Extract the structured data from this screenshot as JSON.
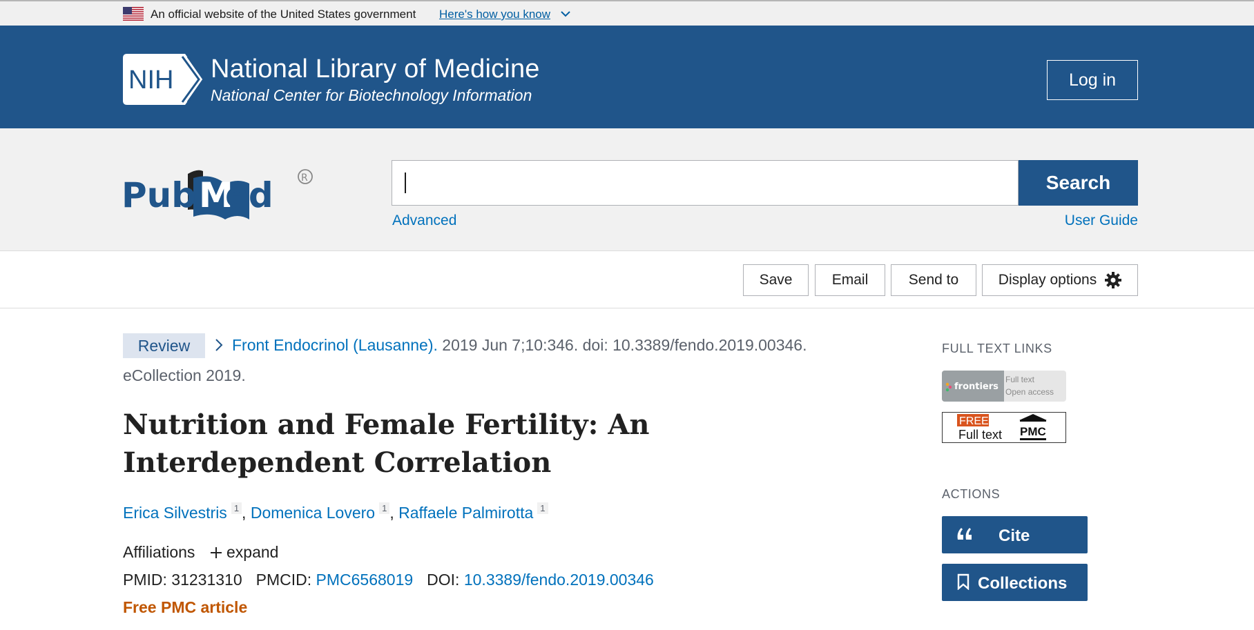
{
  "gov_banner": {
    "text": "An official website of the United States government",
    "link": "Here's how you know"
  },
  "header": {
    "logo_text": "NIH",
    "title": "National Library of Medicine",
    "subtitle": "National Center for Biotechnology Information",
    "login_label": "Log in"
  },
  "search": {
    "logo_text": "PubMed",
    "value": "",
    "button_label": "Search",
    "advanced_label": "Advanced",
    "guide_label": "User Guide"
  },
  "toolbar": {
    "save_label": "Save",
    "email_label": "Email",
    "send_label": "Send to",
    "display_label": "Display options"
  },
  "article": {
    "badge": "Review",
    "journal": "Front Endocrinol (Lausanne).",
    "citation": " 2019 Jun 7;10:346. doi: 10.3389/fendo.2019.00346.",
    "ecollection": "eCollection 2019.",
    "title": "Nutrition and Female Fertility: An Interdependent Correlation",
    "authors": [
      {
        "name": "Erica Silvestris",
        "aff": "1"
      },
      {
        "name": "Domenica Lovero",
        "aff": "1"
      },
      {
        "name": "Raffaele Palmirotta",
        "aff": "1"
      }
    ],
    "affiliations_label": "Affiliations",
    "expand_label": "expand",
    "pmid_label": "PMID:",
    "pmid": "31231310",
    "pmcid_label": "PMCID:",
    "pmcid": "PMC6568019",
    "doi_label": "DOI:",
    "doi": "10.3389/fendo.2019.00346",
    "free_label": "Free PMC article"
  },
  "sidebar": {
    "full_text_heading": "FULL TEXT LINKS",
    "frontiers": {
      "brand": "frontiers",
      "line1": "Full text",
      "line2": "Open access"
    },
    "pmc": {
      "free": "FREE",
      "full_text": "Full text",
      "brand": "PMC"
    },
    "actions_heading": "ACTIONS",
    "cite_label": "Cite",
    "collections_label": "Collections"
  },
  "colors": {
    "nih_blue": "#20558a",
    "link_blue": "#0071bc",
    "free_orange": "#c05600",
    "badge_bg": "#dde4ef"
  }
}
